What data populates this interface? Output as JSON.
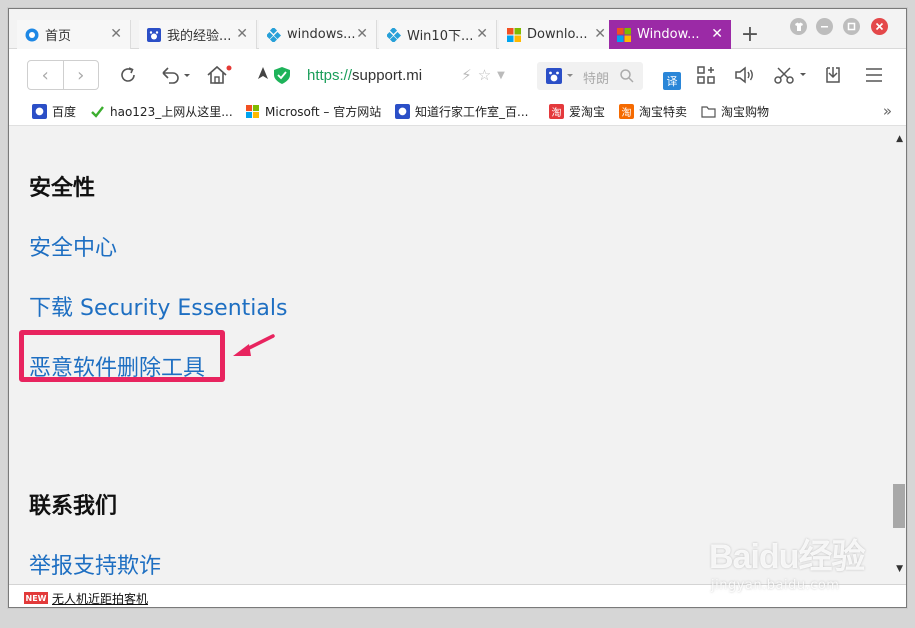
{
  "tabs": [
    {
      "title": "首页",
      "icon": "browser-home-icon"
    },
    {
      "title": "我的经验...",
      "icon": "baidu-paw-icon"
    },
    {
      "title": "windows...",
      "icon": "diamond-icon"
    },
    {
      "title": "Win10下...",
      "icon": "diamond-icon"
    },
    {
      "title": "Downlo...",
      "icon": "microsoft-logo-icon"
    },
    {
      "title": "Window...",
      "icon": "windows-logo-icon",
      "active": true
    }
  ],
  "new_tab_label": "+",
  "address": {
    "scheme": "https://",
    "host": "support.mi"
  },
  "search": {
    "placeholder": "特朗"
  },
  "translate_label": "译",
  "bookmarks": [
    {
      "label": "百度",
      "icon": "baidu-paw-icon"
    },
    {
      "label": "hao123_上网从这里...",
      "icon": "hao123-icon"
    },
    {
      "label": "Microsoft – 官方网站",
      "icon": "microsoft-logo-icon"
    },
    {
      "label": "知道行家工作室_百...",
      "icon": "baidu-paw-icon"
    },
    {
      "label": "爱淘宝",
      "icon": "taobao-icon"
    },
    {
      "label": "淘宝特卖",
      "icon": "taobao-icon"
    },
    {
      "label": "淘宝购物",
      "icon": "folder-icon"
    }
  ],
  "content": {
    "section1_title": "安全性",
    "link_security_center": "安全中心",
    "link_download_se": "下载 Security Essentials",
    "link_malware_tool": "恶意软件删除工具",
    "section2_title": "联系我们",
    "link_report_scam": "举报支持欺诈"
  },
  "status": {
    "badge": "NEW",
    "news": "无人机近距拍客机"
  },
  "watermark": {
    "logo": "Baidu经验",
    "sub": "jingyan.baidu.com"
  },
  "colors": {
    "active_tab": "#9b2aa6",
    "link": "#1e6fc2",
    "highlight": "#e8245f",
    "https_green": "#1a9e5a"
  }
}
